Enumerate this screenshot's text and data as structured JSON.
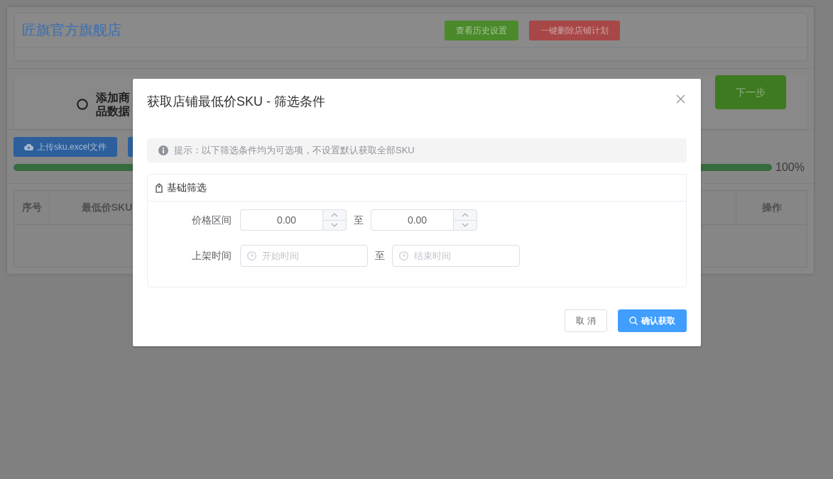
{
  "page": {
    "shop_name": "匠旗官方旗舰店",
    "header_buttons": [
      {
        "label": "查看历史设置",
        "kind": "success"
      },
      {
        "label": "一键删除店铺计划",
        "kind": "danger"
      }
    ],
    "steps": [
      {
        "title": "添加商品数据"
      }
    ],
    "next_button": "下一步",
    "toolbar": {
      "upload_button": "上传sku.excel文件"
    },
    "progress": {
      "level": 1,
      "reading": "100%"
    },
    "table": {
      "columns": [
        {
          "label": "序号",
          "kind": "index"
        },
        {
          "label": "最低价SKU",
          "kind": "sku"
        },
        {
          "label": "操作",
          "kind": "actions"
        }
      ]
    }
  },
  "dialog": {
    "title": "获取店铺最低价SKU - 筛选条件",
    "hint": "提示：以下筛选条件均为可选项，不设置默认获取全部SKU",
    "section": {
      "title": "基础筛选",
      "rows": [
        {
          "kind": "number-range",
          "label": "价格区间",
          "from": {
            "value": "0.00"
          },
          "separator": "至",
          "to": {
            "value": "0.00"
          }
        },
        {
          "kind": "date-range",
          "label": "上架时间",
          "from": {
            "placeholder": "开始时间"
          },
          "separator": "至",
          "to": {
            "placeholder": "结束时间"
          }
        }
      ]
    },
    "buttons": [
      {
        "label": "取 消",
        "kind": "default"
      },
      {
        "label": "确认获取",
        "kind": "primary"
      }
    ]
  }
}
